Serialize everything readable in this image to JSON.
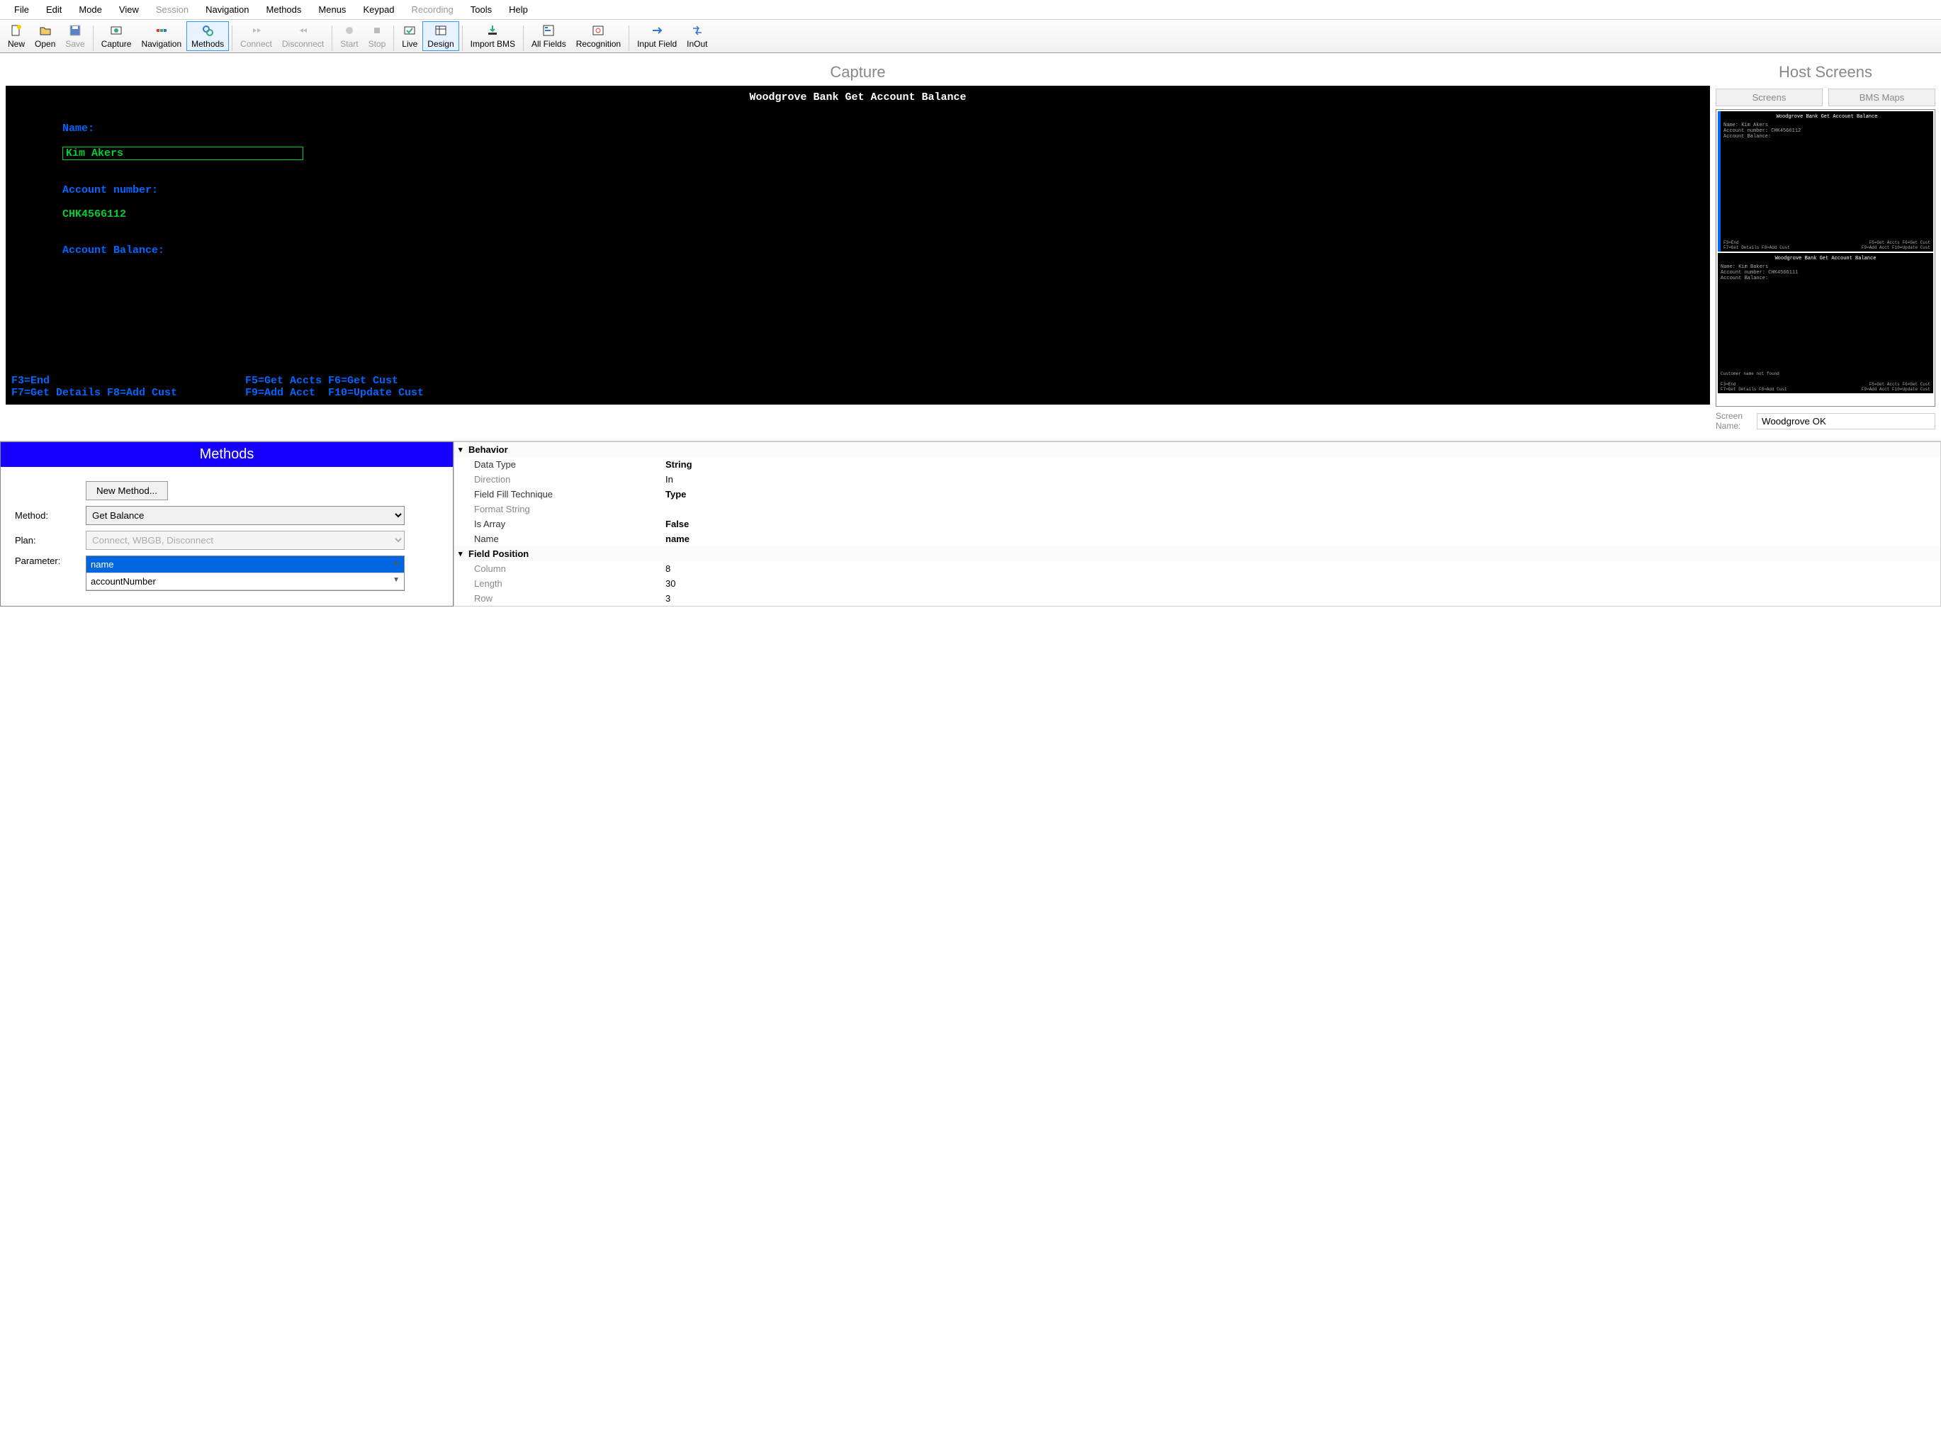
{
  "menubar": [
    "File",
    "Edit",
    "Mode",
    "View",
    "Session",
    "Navigation",
    "Methods",
    "Menus",
    "Keypad",
    "Recording",
    "Tools",
    "Help"
  ],
  "menubar_disabled": [
    "Session",
    "Recording"
  ],
  "toolbar": [
    {
      "label": "New",
      "icon": "new",
      "group": 0
    },
    {
      "label": "Open",
      "icon": "open",
      "group": 0
    },
    {
      "label": "Save",
      "icon": "save",
      "disabled": true,
      "group": 0
    },
    {
      "label": "Capture",
      "icon": "capture",
      "group": 1
    },
    {
      "label": "Navigation",
      "icon": "nav",
      "group": 1
    },
    {
      "label": "Methods",
      "icon": "methods",
      "selected": true,
      "group": 1
    },
    {
      "label": "Connect",
      "icon": "connect",
      "disabled": true,
      "group": 2
    },
    {
      "label": "Disconnect",
      "icon": "disconnect",
      "disabled": true,
      "group": 2
    },
    {
      "label": "Start",
      "icon": "start",
      "disabled": true,
      "group": 3
    },
    {
      "label": "Stop",
      "icon": "stop",
      "disabled": true,
      "group": 3
    },
    {
      "label": "Live",
      "icon": "live",
      "group": 4
    },
    {
      "label": "Design",
      "icon": "design",
      "selected": true,
      "group": 4
    },
    {
      "label": "Import BMS",
      "icon": "import",
      "group": 5
    },
    {
      "label": "All Fields",
      "icon": "allfields",
      "group": 6
    },
    {
      "label": "Recognition",
      "icon": "recog",
      "group": 6
    },
    {
      "label": "Input Field",
      "icon": "inputfield",
      "group": 7
    },
    {
      "label": "InOut",
      "icon": "inout",
      "group": 7
    }
  ],
  "capture": {
    "title": "Capture",
    "terminal": {
      "header": "Woodgrove Bank Get Account Balance",
      "name_label": "Name:",
      "name_value": "Kim Akers",
      "acct_label": "Account number:",
      "acct_value": "CHK4566112",
      "bal_label": "Account Balance:",
      "footer": {
        "l1a": "F3=End",
        "l1b": "F5=Get Accts F6=Get Cust",
        "l2a": "F7=Get Details F8=Add Cust",
        "l2b": "F9=Add Acct  F10=Update Cust"
      }
    }
  },
  "hostscreens": {
    "title": "Host Screens",
    "tabs": [
      "Screens",
      "BMS Maps"
    ],
    "screen_name_label": "Screen Name:",
    "screen_name_value": "Woodgrove OK",
    "thumbs": [
      {
        "header": "Woodgrove Bank Get Account Balance",
        "lines": [
          "Name:  Kim Akers",
          "Account number:  CHK4566112",
          "Account Balance:"
        ],
        "footer": [
          [
            "F3=End",
            "F5=Get Accts F6=Get Cust"
          ],
          [
            "F7=Get Details F8=Add Cust",
            "F9=Add Acct  F10=Update Cust"
          ]
        ],
        "selected": true
      },
      {
        "header": "Woodgrove Bank Get Account Balance",
        "lines": [
          "Name:  Kim Bakers",
          "Account number:  CHK4566111",
          "Account Balance:"
        ],
        "message": "Customer name not found",
        "footer": [
          [
            "F3=End",
            "F5=Get Accts F6=Get Cust"
          ],
          [
            "F7=Get Details F8=Add Cust",
            "F9=Add Acct  F10=Update Cust"
          ]
        ],
        "selected": false
      }
    ]
  },
  "methods": {
    "title": "Methods",
    "new_method_btn": "New Method...",
    "method_label": "Method:",
    "method_value": "Get Balance",
    "plan_label": "Plan:",
    "plan_value": "Connect, WBGB, Disconnect",
    "param_label": "Parameter:",
    "params": [
      {
        "name": "name",
        "selected": true
      },
      {
        "name": "accountNumber",
        "selected": false
      }
    ]
  },
  "properties": {
    "behavior_cat": "Behavior",
    "behavior": [
      {
        "label": "Data Type",
        "value": "String",
        "bold": true
      },
      {
        "label": "Direction",
        "value": "In",
        "dim": true
      },
      {
        "label": "Field Fill Technique",
        "value": "Type",
        "bold": true
      },
      {
        "label": "Format String",
        "value": "",
        "dim": true
      },
      {
        "label": "Is Array",
        "value": "False",
        "bold": true
      },
      {
        "label": "Name",
        "value": "name",
        "bold": true
      }
    ],
    "position_cat": "Field Position",
    "position": [
      {
        "label": "Column",
        "value": "8",
        "dim": true
      },
      {
        "label": "Length",
        "value": "30",
        "dim": true
      },
      {
        "label": "Row",
        "value": "3",
        "dim": true
      }
    ]
  }
}
